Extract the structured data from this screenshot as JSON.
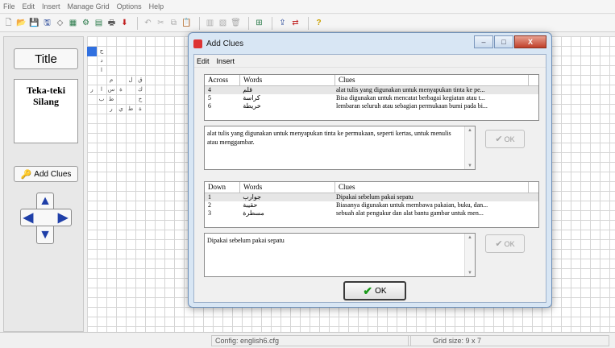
{
  "menu": [
    "File",
    "Edit",
    "Insert",
    "Manage Grid",
    "Options",
    "Help"
  ],
  "toolbar_icons": [
    {
      "name": "new-file-icon",
      "glyph": "🗋"
    },
    {
      "name": "open-folder-icon",
      "glyph": "📂"
    },
    {
      "name": "save-icon",
      "glyph": "💾"
    },
    {
      "name": "save-as-icon",
      "glyph": "🖫"
    },
    {
      "name": "shape-icon",
      "glyph": "◇"
    },
    {
      "name": "grid-icon",
      "glyph": "▦"
    },
    {
      "name": "settings-icon",
      "glyph": "⚙"
    },
    {
      "name": "page-icon",
      "glyph": "▤"
    },
    {
      "name": "print-icon",
      "glyph": "🖶"
    },
    {
      "name": "arrow-down-icon",
      "glyph": "⬇"
    },
    {
      "name": "undo-icon",
      "glyph": "↶"
    },
    {
      "name": "cut-icon",
      "glyph": "✂"
    },
    {
      "name": "copy-icon",
      "glyph": "⧉"
    },
    {
      "name": "paste-icon",
      "glyph": "📋"
    },
    {
      "name": "fill-icon",
      "glyph": "▥"
    },
    {
      "name": "layers-icon",
      "glyph": "▧"
    },
    {
      "name": "delete-icon",
      "glyph": "🗑"
    },
    {
      "name": "grid-resize-icon",
      "glyph": "⊞"
    },
    {
      "name": "export-icon",
      "glyph": "⇪"
    },
    {
      "name": "sync-icon",
      "glyph": "⇄"
    },
    {
      "name": "help-icon",
      "glyph": "?"
    }
  ],
  "left_panel": {
    "title_button": "Title",
    "title_text": "Teka-teki Silang",
    "add_clues_button": "Add Clues",
    "arrows": {
      "up": "▲",
      "down": "▼",
      "left": "◀",
      "right": "▶"
    }
  },
  "grid_letters": [
    "ج",
    "د",
    "ا",
    "م",
    "ل",
    "ق",
    "ر",
    "ا",
    "س",
    "ة",
    "ك",
    "ب",
    "ط",
    "خ",
    "ر",
    "ي",
    "ط",
    "ة"
  ],
  "dialog": {
    "title": "Add Clues",
    "menu": [
      "Edit",
      "Insert"
    ],
    "win_buttons": {
      "minimize": "–",
      "maximize": "□",
      "close": "X"
    },
    "across": {
      "headers": [
        "Across",
        "Words",
        "Clues"
      ],
      "rows": [
        {
          "num": "4",
          "word": "قلم",
          "clue": "alat tulis yang digunakan untuk menyapukan tinta ke pe..."
        },
        {
          "num": "5",
          "word": "كراسة",
          "clue": "Bisa digunakan untuk mencatat berbagai kegiatan atau t..."
        },
        {
          "num": "6",
          "word": "خريطة",
          "clue": "lembaran seluruh atau sebagian permukaan bumi pada bi..."
        }
      ],
      "detail": "alat tulis yang digunakan untuk menyapukan tinta ke permukaan, seperti kertas, untuk menulis atau menggambar."
    },
    "down": {
      "headers": [
        "Down",
        "Words",
        "Clues"
      ],
      "rows": [
        {
          "num": "1",
          "word": "جوارب",
          "clue": "Dipakai sebelum pakai sepatu"
        },
        {
          "num": "2",
          "word": "حقيبة",
          "clue": "Biasanya digunakan untuk membawa pakaian, buku, dan..."
        },
        {
          "num": "3",
          "word": "مسطرة",
          "clue": "sebuah alat pengukur dan alat bantu gambar untuk men..."
        }
      ],
      "detail": "Dipakai sebelum pakai sepatu"
    },
    "ok_small": "OK",
    "ok_main": "OK"
  },
  "status": {
    "config": "Config: english6.cfg",
    "grid_size": "Grid size: 9 x 7"
  }
}
